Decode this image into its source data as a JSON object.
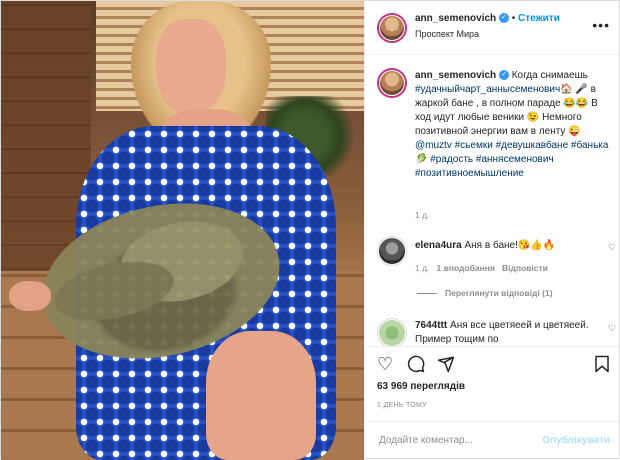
{
  "post_author": {
    "username": "ann_semenovich",
    "follow_label": "Стежити",
    "location": "Проспект Мира",
    "verified_icon": "verified-badge-icon",
    "more_icon": "more-options-icon"
  },
  "caption": {
    "username": "ann_semenovich",
    "text_1": "Когда снимаешь",
    "tag_1": "#удачныйчарт_аннысеменович",
    "emoji_1": "🏠",
    "emoji_2": "🎤",
    "text_2": "в жаркой бане , в полном параде",
    "emoji_3": "😂😂",
    "text_3": "В ход идут любые веники",
    "emoji_4": "😉",
    "text_4": "Немного позитивной энергии вам в ленту",
    "emoji_5": "😜",
    "mention": "@muztv",
    "tag_2": "#сьемки",
    "tag_3": "#девушкавбане",
    "tag_4": "#банька",
    "emoji_6": "🥬",
    "tag_5": "#радость",
    "tag_6": "#аннясеменович",
    "tag_7": "#позитивноемышление",
    "age": "1 д."
  },
  "comments": [
    {
      "username": "elena4ura",
      "text": "Аня в бане!",
      "emoji": "😘👍🔥",
      "age": "1 д.",
      "likes": "1 вподобання",
      "reply_label": "Відповісти",
      "view_replies": "Переглянути відповіді (1)"
    },
    {
      "username": "7644ttt",
      "text": "Аня все цветяеей и цветяеей. Пример тощим по"
    }
  ],
  "actions": {
    "like_icon": "heart-icon",
    "comment_icon": "comment-icon",
    "share_icon": "share-icon",
    "save_icon": "bookmark-icon"
  },
  "views": "63 969 переглядів",
  "post_time": "1 ДЕНЬ ТОМУ",
  "add_comment": {
    "placeholder": "Додайте коментар...",
    "post_label": "Опублікувати"
  },
  "colors": {
    "link": "#0095f6",
    "hashtag": "#00376b",
    "muted": "#8e8e8e"
  }
}
